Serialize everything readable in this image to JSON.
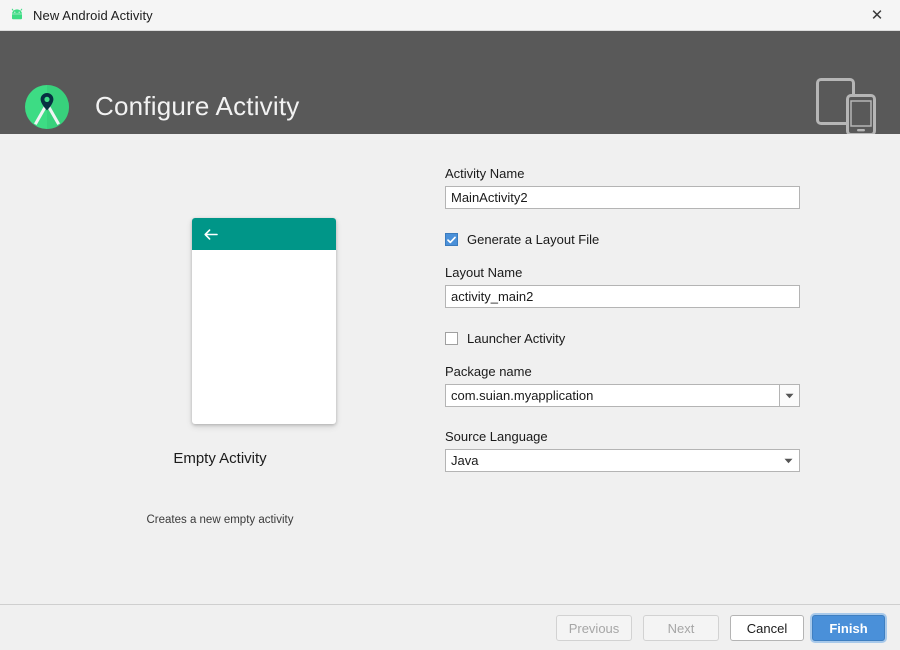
{
  "window": {
    "title": "New Android Activity",
    "icon": "android-robot-icon",
    "close_label": "✕"
  },
  "header": {
    "title": "Configure Activity",
    "logo_icon": "android-studio-logo-icon",
    "devices_icon": "tablet-and-phone-icon",
    "background": "#595959"
  },
  "preview": {
    "template_name": "Empty Activity",
    "description": "Creates a new empty activity",
    "appbar_color": "#009688",
    "back_icon": "back-arrow-icon"
  },
  "form": {
    "activity_name": {
      "label": "Activity Name",
      "value": "MainActivity2",
      "placeholder": "Activity Name"
    },
    "generate_layout": {
      "label": "Generate a Layout File",
      "checked": "true"
    },
    "layout_name": {
      "label": "Layout Name",
      "value": "activity_main2",
      "placeholder": "Layout Name"
    },
    "launcher_activity": {
      "label": "Launcher Activity",
      "checked": "false"
    },
    "package_name": {
      "label": "Package name",
      "value": "com.suian.myapplication",
      "dropdown_icon": "chevron-down-icon"
    },
    "source_language": {
      "label": "Source Language",
      "value": "Java",
      "dropdown_icon": "chevron-down-icon"
    }
  },
  "footer": {
    "previous_label": "Previous",
    "next_label": "Next",
    "cancel_label": "Cancel",
    "finish_label": "Finish"
  },
  "colors": {
    "accent_blue": "#4a90d9",
    "teal": "#009688",
    "header_grey": "#595959",
    "background": "#f0f0f0"
  }
}
